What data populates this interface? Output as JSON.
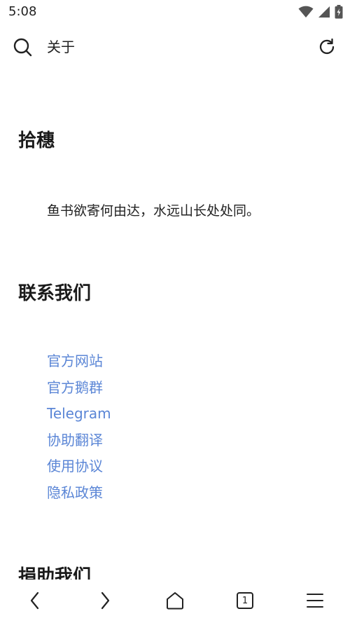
{
  "status_bar": {
    "time": "5:08",
    "icons": [
      "wifi-icon",
      "cellular-signal-icon",
      "battery-charging-icon"
    ]
  },
  "toolbar": {
    "title": "关于",
    "left_icon": "search-icon",
    "right_icon": "refresh-icon"
  },
  "sections": {
    "intro": {
      "heading": "拾穗",
      "quote": "鱼书欲寄何由达，水远山长处处同。"
    },
    "contact": {
      "heading": "联系我们",
      "links": [
        "官方网站",
        "官方鹅群",
        "Telegram",
        "协助翻译",
        "使用协议",
        "隐私政策"
      ]
    },
    "donate": {
      "heading": "捐助我们"
    }
  },
  "bottom_nav": {
    "tab_count": "1",
    "icons": [
      "back-arrow-icon",
      "forward-arrow-icon",
      "home-icon",
      "tabs-icon",
      "menu-icon"
    ]
  },
  "colors": {
    "link": "#5b86d6",
    "text": "#1a1a1a",
    "background": "#ffffff"
  }
}
